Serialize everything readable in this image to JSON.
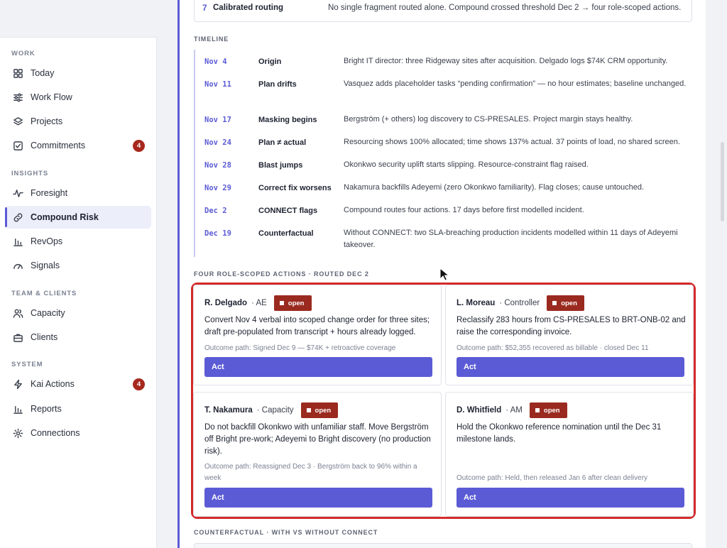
{
  "sidebar": {
    "sections": {
      "work": "WORK",
      "insights": "INSIGHTS",
      "team": "TEAM & CLIENTS",
      "system": "SYSTEM"
    },
    "items": [
      {
        "label": "Today",
        "icon": "grid-icon"
      },
      {
        "label": "Work Flow",
        "icon": "sliders-icon"
      },
      {
        "label": "Projects",
        "icon": "layers-icon"
      },
      {
        "label": "Commitments",
        "icon": "checkbox-icon",
        "badge": "4"
      },
      {
        "label": "Foresight",
        "icon": "pulse-icon"
      },
      {
        "label": "Compound Risk",
        "icon": "link-icon",
        "active": true
      },
      {
        "label": "RevOps",
        "icon": "bar-chart-icon"
      },
      {
        "label": "Signals",
        "icon": "gauge-icon"
      },
      {
        "label": "Capacity",
        "icon": "users-icon"
      },
      {
        "label": "Clients",
        "icon": "briefcase-icon"
      },
      {
        "label": "Kai Actions",
        "icon": "bolt-icon",
        "badge": "4"
      },
      {
        "label": "Reports",
        "icon": "bar-chart-icon"
      },
      {
        "label": "Connections",
        "icon": "gear-icon"
      }
    ]
  },
  "routing": {
    "num": "7",
    "label": "Calibrated routing",
    "desc": "No single fragment routed alone. Compound crossed threshold Dec 2 → four role-scoped actions."
  },
  "timeline": {
    "title": "TIMELINE",
    "rows": [
      {
        "date": "Nov 4",
        "label": "Origin",
        "desc": "Bright IT director: three Ridgeway sites after acquisition. Delgado logs $74K CRM opportunity."
      },
      {
        "date": "Nov 11",
        "label": "Plan drifts",
        "desc": "Vasquez adds placeholder tasks “pending confirmation” — no hour estimates; baseline unchanged."
      },
      {
        "date": "Nov 17",
        "label": "Masking begins",
        "desc": "Bergström (+ others) log discovery to CS-PRESALES. Project margin stays healthy."
      },
      {
        "date": "Nov 24",
        "label": "Plan ≠ actual",
        "desc": "Resourcing shows 100% allocated; time shows 137% actual. 37 points of load, no shared screen."
      },
      {
        "date": "Nov 28",
        "label": "Blast jumps",
        "desc": "Okonkwo security uplift starts slipping. Resource-constraint flag raised."
      },
      {
        "date": "Nov 29",
        "label": "Correct fix worsens",
        "desc": "Nakamura backfills Adeyemi (zero Okonkwo familiarity). Flag closes; cause untouched."
      },
      {
        "date": "Dec 2",
        "label": "CONNECT flags",
        "desc": "Compound routes four actions. 17 days before first modelled incident."
      },
      {
        "date": "Dec 19",
        "label": "Counterfactual",
        "desc": "Without CONNECT: two SLA-breaching production incidents modelled within 11 days of Adeyemi takeover."
      }
    ]
  },
  "actions": {
    "title": "FOUR ROLE-SCOPED ACTIONS · ROUTED DEC 2",
    "open_label": "open",
    "act_label": "Act",
    "cards": [
      {
        "name": "R. Delgado",
        "role": "· AE",
        "body": "Convert Nov 4 verbal into scoped change order for three sites; draft pre-populated from transcript + hours already logged.",
        "outcome": "Outcome path: Signed Dec 9 — $74K + retroactive coverage"
      },
      {
        "name": "L. Moreau",
        "role": "· Controller",
        "body": "Reclassify 283 hours from CS-PRESALES to BRT-ONB-02 and raise the corresponding invoice.",
        "outcome": "Outcome path: $52,355 recovered as billable · closed Dec 11"
      },
      {
        "name": "T. Nakamura",
        "role": "· Capacity",
        "body": "Do not backfill Okonkwo with unfamiliar staff. Move Bergström off Bright pre-work; Adeyemi to Bright discovery (no production risk).",
        "outcome": "Outcome path: Reassigned Dec 3 · Bergström back to 96% within a week"
      },
      {
        "name": "D. Whitfield",
        "role": "· AM",
        "body": "Hold the Okonkwo reference nomination until the Dec 31 milestone lands.",
        "outcome": "Outcome path: Held, then released Jan 6 after clean delivery"
      }
    ]
  },
  "counterfactual": {
    "title": "COUNTERFACTUAL · WITH VS WITHOUT CONNECT"
  }
}
